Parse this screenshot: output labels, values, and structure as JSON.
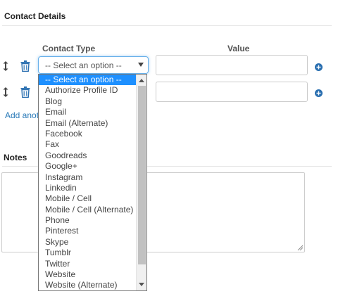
{
  "contact_section": {
    "title": "Contact Details"
  },
  "columns": {
    "contact_type": "Contact Type",
    "value": "Value"
  },
  "rows": [
    {
      "selected_type": "-- Select an option --",
      "value": ""
    },
    {
      "selected_type": "",
      "value": ""
    }
  ],
  "add_link": "Add anot",
  "notes_section": {
    "title": "Notes"
  },
  "notes_value": "",
  "dropdown": {
    "options": [
      "-- Select an option --",
      "Authorize Profile ID",
      "Blog",
      "Email",
      "Email (Alternate)",
      "Facebook",
      "Fax",
      "Goodreads",
      "Google+",
      "Instagram",
      "Linkedin",
      "Mobile / Cell",
      "Mobile / Cell (Alternate)",
      "Phone",
      "Pinterest",
      "Skype",
      "Tumblr",
      "Twitter",
      "Website",
      "Website (Alternate)"
    ],
    "selected_index": 0
  },
  "colors": {
    "accent": "#1e90ff",
    "link": "#2a7ab8",
    "icon": "#2a6fb0",
    "focus_border": "#66afe9"
  },
  "icons": [
    "drag-handle-icon",
    "trash-icon",
    "plus-circle-icon",
    "caret-down-icon",
    "resize-grip-icon"
  ]
}
